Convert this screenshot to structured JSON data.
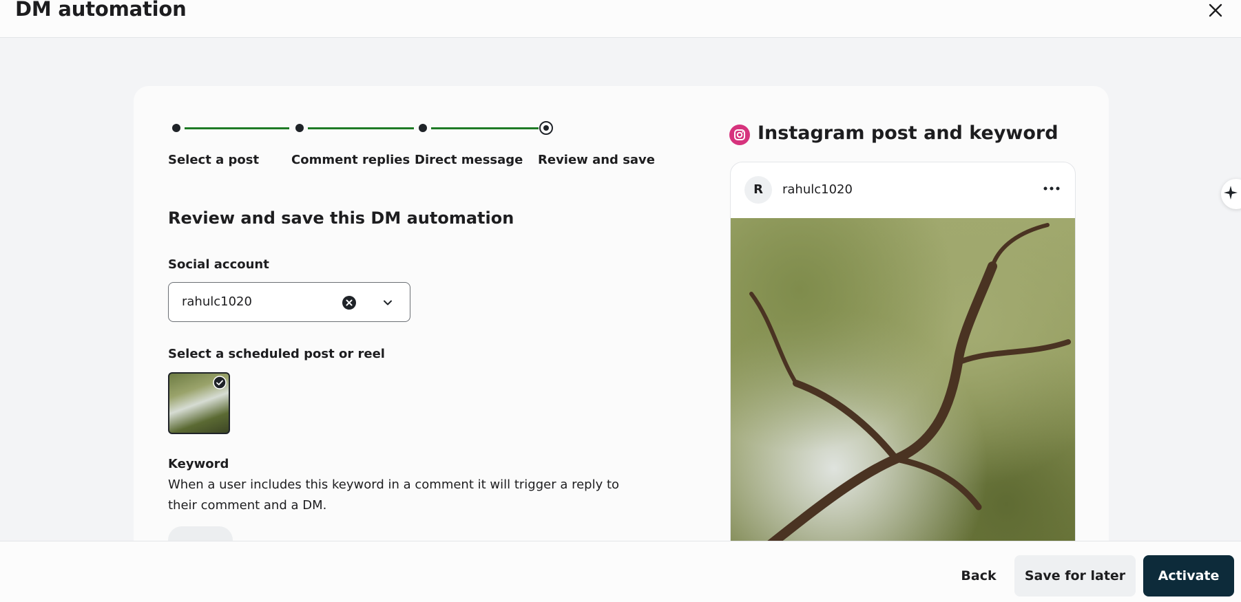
{
  "header": {
    "title": "DM automation"
  },
  "stepper": {
    "steps": [
      {
        "label": "Select a post"
      },
      {
        "label": "Comment replies"
      },
      {
        "label": "Direct message"
      },
      {
        "label": "Review and save"
      }
    ],
    "current_step": 4
  },
  "main": {
    "section_title": "Review and save this DM automation",
    "social_account": {
      "label": "Social account",
      "value": "rahulc1020"
    },
    "post_select": {
      "label": "Select a scheduled post or reel"
    },
    "keyword": {
      "label": "Keyword",
      "description": "When a user includes this keyword in a comment it will trigger a reply to their comment and a DM."
    }
  },
  "preview": {
    "title": "Instagram post and keyword",
    "avatar_initial": "R",
    "username": "rahulc1020"
  },
  "footer": {
    "back_label": "Back",
    "save_later_label": "Save for later",
    "activate_label": "Activate"
  },
  "colors": {
    "progress_line": "#1e7a25",
    "primary_button": "#0d2b3a",
    "instagram": "#d6337d"
  }
}
